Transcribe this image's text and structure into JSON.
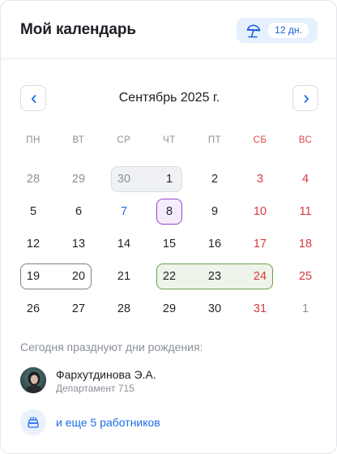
{
  "header": {
    "title": "Мой календарь",
    "vacation_badge": {
      "icon": "umbrella-icon",
      "days_label": "12 дн."
    }
  },
  "calendar": {
    "month_label": "Сентябрь 2025 г.",
    "prev_icon": "chevron-left-icon",
    "next_icon": "chevron-right-icon",
    "weekdays": [
      "ПН",
      "ВТ",
      "СР",
      "ЧТ",
      "ПТ",
      "СБ",
      "ВС"
    ],
    "weeks": [
      [
        "28",
        "29",
        "30",
        "1",
        "2",
        "3",
        "4"
      ],
      [
        "5",
        "6",
        "7",
        "8",
        "9",
        "10",
        "11"
      ],
      [
        "12",
        "13",
        "14",
        "15",
        "16",
        "17",
        "18"
      ],
      [
        "19",
        "20",
        "21",
        "22",
        "23",
        "24",
        "25"
      ],
      [
        "26",
        "27",
        "28",
        "29",
        "30",
        "31",
        "1"
      ]
    ]
  },
  "birthdays": {
    "title": "Сегодня празднуют дни рождения:",
    "person": {
      "name": "Фархутдинова Э.А.",
      "department": "Департамент 715",
      "icon": "avatar"
    },
    "more": {
      "label": "и еще 5 работников",
      "icon": "cake-icon"
    }
  },
  "colors": {
    "accent_blue": "#1c6ee8",
    "weekend_red": "#e0484b",
    "range_green": "#6a9f4a",
    "range_purple": "#9d44c8"
  }
}
